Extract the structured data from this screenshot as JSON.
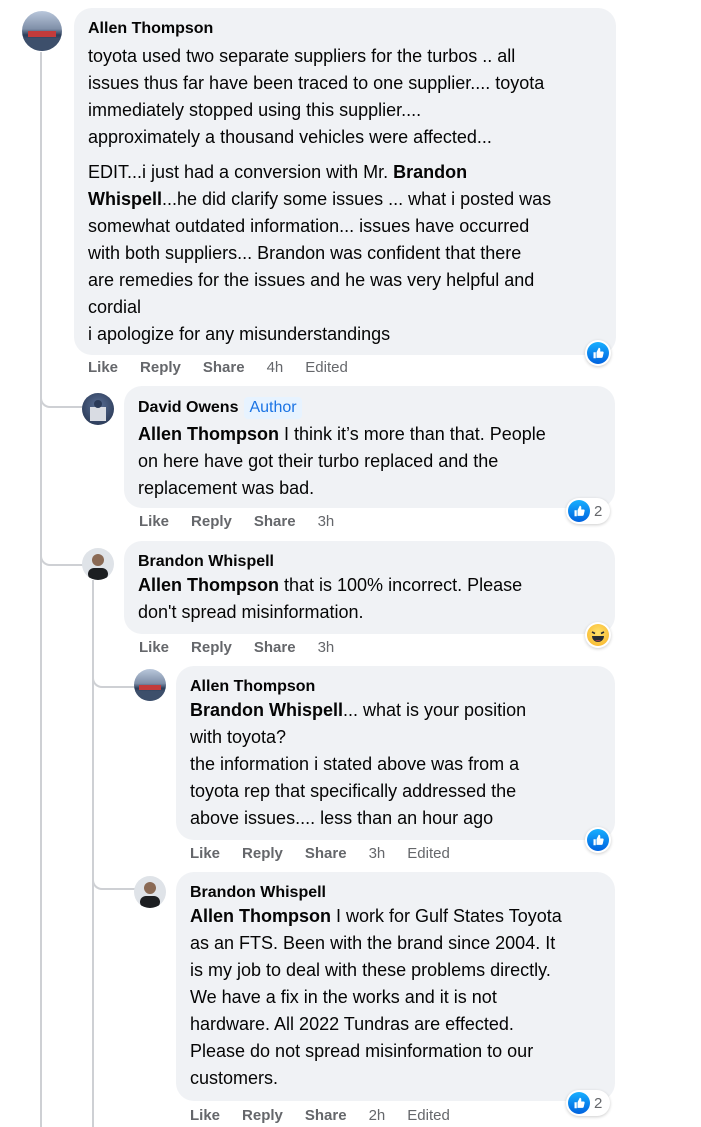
{
  "comments": [
    {
      "author": "Allen Thompson",
      "body": [
        [
          [
            "toyota used two separate suppliers for the turbos .. all"
          ]
        ],
        [
          [
            "issues thus far have been traced to one supplier.... toyota"
          ]
        ],
        [
          [
            "immediately stopped using this supplier...."
          ]
        ],
        [
          [
            "approximately a thousand vehicles were affected..."
          ]
        ],
        [
          [
            "EDIT...i just had a conversion with Mr. "
          ],
          [
            "Brandon",
            true
          ]
        ],
        [
          [
            "Whispell",
            true
          ],
          [
            "...he did clarify some issues ... what i posted was"
          ]
        ],
        [
          [
            "somewhat outdated information... issues have occurred"
          ]
        ],
        [
          [
            "with both suppliers... Brandon was confident that there"
          ]
        ],
        [
          [
            "are remedies for the issues and he was very helpful and"
          ]
        ],
        [
          [
            "cordial"
          ]
        ],
        [
          [
            "i apologize for any misunderstandings"
          ]
        ]
      ],
      "actions": {
        "like": "Like",
        "reply": "Reply",
        "share": "Share",
        "time": "4h",
        "edited": "Edited"
      },
      "reaction": {
        "type": "like",
        "count": ""
      }
    },
    {
      "author": "David Owens",
      "badge": "Author",
      "body": [
        [
          [
            "Allen Thompson",
            true
          ],
          [
            " I think it’s more than that. People"
          ]
        ],
        [
          [
            "on here have got their turbo replaced and the"
          ]
        ],
        [
          [
            "replacement was bad."
          ]
        ]
      ],
      "actions": {
        "like": "Like",
        "reply": "Reply",
        "share": "Share",
        "time": "3h",
        "edited": ""
      },
      "reaction": {
        "type": "like",
        "count": "2"
      }
    },
    {
      "author": "Brandon Whispell",
      "body": [
        [
          [
            "Allen Thompson",
            true
          ],
          [
            " that is 100% incorrect. Please"
          ]
        ],
        [
          [
            "don't spread misinformation."
          ]
        ]
      ],
      "actions": {
        "like": "Like",
        "reply": "Reply",
        "share": "Share",
        "time": "3h",
        "edited": ""
      },
      "reaction": {
        "type": "haha",
        "count": ""
      }
    },
    {
      "author": "Allen Thompson",
      "body": [
        [
          [
            "Brandon Whispell",
            true
          ],
          [
            "... what is your position"
          ]
        ],
        [
          [
            "with toyota?"
          ]
        ],
        [
          [
            "the information i stated above was from a"
          ]
        ],
        [
          [
            "toyota rep that specifically addressed the"
          ]
        ],
        [
          [
            "above issues.... less than an hour ago"
          ]
        ]
      ],
      "actions": {
        "like": "Like",
        "reply": "Reply",
        "share": "Share",
        "time": "3h",
        "edited": "Edited"
      },
      "reaction": {
        "type": "like",
        "count": ""
      }
    },
    {
      "author": "Brandon Whispell",
      "body": [
        [
          [
            "Allen Thompson",
            true
          ],
          [
            " I work for Gulf States Toyota"
          ]
        ],
        [
          [
            "as an FTS. Been with the brand since 2004. It"
          ]
        ],
        [
          [
            "is my job to deal with these problems directly."
          ]
        ],
        [
          [
            "We have a fix in the works and it is not"
          ]
        ],
        [
          [
            "hardware. All 2022 Tundras are effected."
          ]
        ],
        [
          [
            "Please do not spread misinformation to our"
          ]
        ],
        [
          [
            "customers."
          ]
        ]
      ],
      "actions": {
        "like": "Like",
        "reply": "Reply",
        "share": "Share",
        "time": "2h",
        "edited": "Edited"
      },
      "reaction": {
        "type": "like",
        "count": "2"
      }
    }
  ]
}
